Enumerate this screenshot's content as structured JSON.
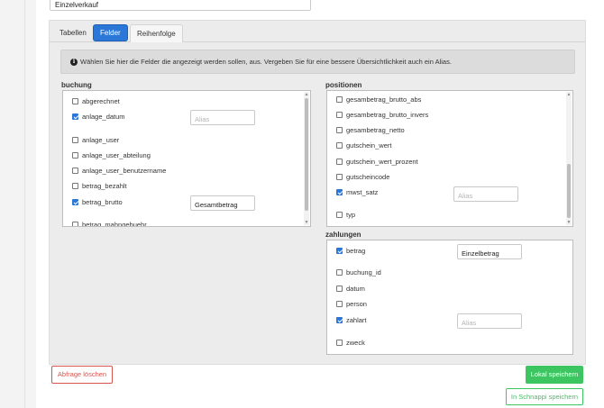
{
  "query_name": "Einzelverkauf",
  "tabs": [
    {
      "label": "Tabellen"
    },
    {
      "label": "Felder",
      "active": true
    },
    {
      "label": "Reihenfolge"
    }
  ],
  "info": {
    "icon": "info-icon",
    "glyph": "i",
    "text": "Wählen Sie hier die Felder die angezeigt werden sollen, aus. Vergeben Sie für eine bessere Übersichtlichkeit auch ein Alias."
  },
  "sections": {
    "buchung": {
      "title": "buchung",
      "fields": [
        {
          "name": "abgerechnet",
          "checked": false
        },
        {
          "name": "anlage_datum",
          "checked": true,
          "alias": "",
          "alias_placeholder": "Alias"
        },
        {
          "name": "anlage_user",
          "checked": false
        },
        {
          "name": "anlage_user_abteilung",
          "checked": false
        },
        {
          "name": "anlage_user_benutzername",
          "checked": false
        },
        {
          "name": "betrag_bezahlt",
          "checked": false
        },
        {
          "name": "betrag_brutto",
          "checked": true,
          "alias": "Gesamtbetrag",
          "alias_placeholder": "Alias"
        },
        {
          "name": "betrag_mahngebuehr",
          "checked": false
        }
      ]
    },
    "positionen": {
      "title": "positionen",
      "fields": [
        {
          "name": "gesambetrag_brutto_abs",
          "checked": false
        },
        {
          "name": "gesambetrag_brutto_invers",
          "checked": false
        },
        {
          "name": "gesambetrag_netto",
          "checked": false
        },
        {
          "name": "gutschein_wert",
          "checked": false
        },
        {
          "name": "gutschein_wert_prozent",
          "checked": false
        },
        {
          "name": "gutscheincode",
          "checked": false
        },
        {
          "name": "mwst_satz",
          "checked": true,
          "alias": "",
          "alias_placeholder": "Alias"
        },
        {
          "name": "typ",
          "checked": false
        }
      ]
    },
    "zahlungen": {
      "title": "zahlungen",
      "fields": [
        {
          "name": "betrag",
          "checked": true,
          "alias": "Einzelbetrag",
          "alias_placeholder": "Alias"
        },
        {
          "name": "buchung_id",
          "checked": false
        },
        {
          "name": "datum",
          "checked": false
        },
        {
          "name": "person",
          "checked": false
        },
        {
          "name": "zahlart",
          "checked": true,
          "alias": "",
          "alias_placeholder": "Alias"
        },
        {
          "name": "zweck",
          "checked": false
        }
      ]
    }
  },
  "buttons": {
    "delete": "Abfrage löschen",
    "save_local": "Lokal speichern",
    "save_schnappi": "In Schnappi speichern"
  },
  "colors": {
    "accent": "#2a77d8",
    "danger": "#d9534f",
    "success": "#3dc561"
  }
}
